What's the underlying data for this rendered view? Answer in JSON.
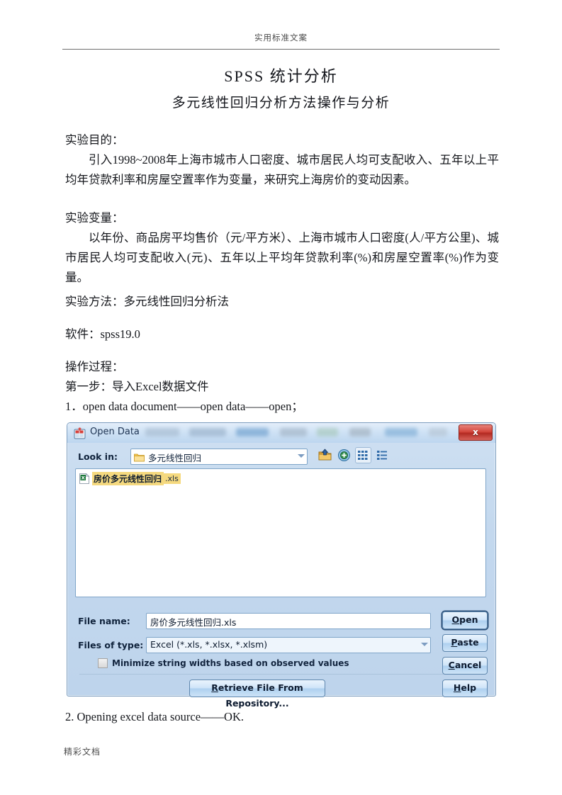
{
  "page": {
    "header_text": "实用标准文案",
    "footer_text": "精彩文档",
    "title": "SPSS  统计分析",
    "subtitle": "多元线性回归分析方法操作与分析"
  },
  "sections": {
    "purpose_heading": "实验目的：",
    "purpose_body": "引入1998~2008年上海市城市人口密度、城市居民人均可支配收入、五年以上平均年贷款利率和房屋空置率作为变量，来研究上海房价的变动因素。",
    "variables_heading": "实验变量：",
    "variables_body": "以年份、商品房平均售价（元/平方米）、上海市城市人口密度(人/平方公里)、城市居民人均可支配收入(元)、五年以上平均年贷款利率(%)和房屋空置率(%)作为变量。",
    "method_line": "实验方法：多元线性回归分析法",
    "software_line": "软件：spss19.0",
    "process_heading": "操作过程：",
    "step_one": "第一步：导入Excel数据文件",
    "step_one_detail": "1．open data document——open data——open；",
    "step_two": "2. Opening excel data source——OK."
  },
  "dialog": {
    "title": "Open Data",
    "title_icon": "spss-open-data-icon",
    "close_label": "x",
    "lookin": {
      "label": "Look in:",
      "value": "多元线性回归",
      "folder_icon": "folder-icon",
      "dropdown_icon": "chevron-down-icon"
    },
    "toolbar_icons": [
      {
        "name": "up-one-level-icon"
      },
      {
        "name": "create-new-folder-icon"
      },
      {
        "name": "list-view-icon"
      },
      {
        "name": "details-view-icon"
      }
    ],
    "files": [
      {
        "name": "房价多元线性回归",
        "ext": ".xls",
        "icon": "excel-file-icon",
        "selected": true
      }
    ],
    "filename": {
      "label": "File name:",
      "value": "房价多元线性回归.xls"
    },
    "filetype": {
      "label": "Files of type:",
      "value": "Excel (*.xls, *.xlsx, *.xlsm)",
      "dropdown_icon": "chevron-down-icon"
    },
    "minimize_checkbox": {
      "label": "Minimize string widths based on observed values",
      "checked": false
    },
    "retrieve_button": {
      "accel": "R",
      "rest": "etrieve File From Repository..."
    },
    "side_buttons": [
      {
        "accel": "O",
        "before": "",
        "rest": "pen",
        "focused": true
      },
      {
        "accel": "P",
        "before": "",
        "rest": "aste",
        "focused": false
      },
      {
        "accel": "C",
        "before": "",
        "rest": "ancel",
        "focused": false
      },
      {
        "accel": "H",
        "before": "",
        "rest": "elp",
        "focused": false
      }
    ]
  },
  "colors": {
    "dialog_bg": "#c3d8ee",
    "titlebar": "#cfe2f5",
    "close_red": "#d3463c",
    "selection_highlight": "#f5d97f",
    "field_border": "#7fa5c9",
    "button_blue": "#cfe4f8"
  }
}
